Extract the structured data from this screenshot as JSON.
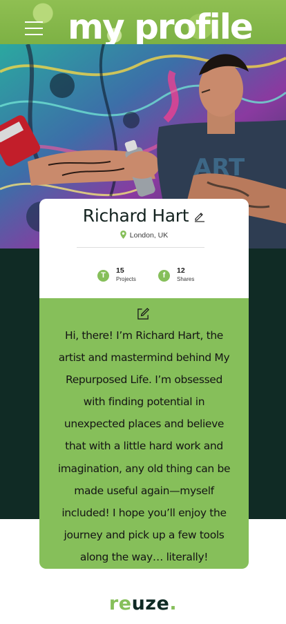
{
  "header": {
    "title": "my profile",
    "menu_icon": "hamburger-menu-icon"
  },
  "profile": {
    "name": "Richard Hart",
    "location": "London, UK",
    "stats": [
      {
        "badge": "T",
        "value": "15",
        "label": "Projects"
      },
      {
        "badge": "f",
        "value": "12",
        "label": "Shares"
      }
    ]
  },
  "bio": {
    "lines": [
      "Hi, there! I’m Richard Hart, the",
      "artist and mastermind behind My",
      "Repurposed Life. I’m obsessed",
      "with finding potential in",
      "unexpected places and believe",
      "that with a little hard work and",
      "imagination, any old thing can be",
      "made useful again—myself",
      "included! I hope you’ll enjoy the",
      "journey and pick up a few tools",
      "along the way… literally!"
    ]
  },
  "footer": {
    "logo_re": "re",
    "logo_uze": "uze",
    "logo_dot": "."
  },
  "colors": {
    "accent_green": "#86bf5a",
    "dark_green": "#102b25",
    "header_green": "#7db144"
  }
}
